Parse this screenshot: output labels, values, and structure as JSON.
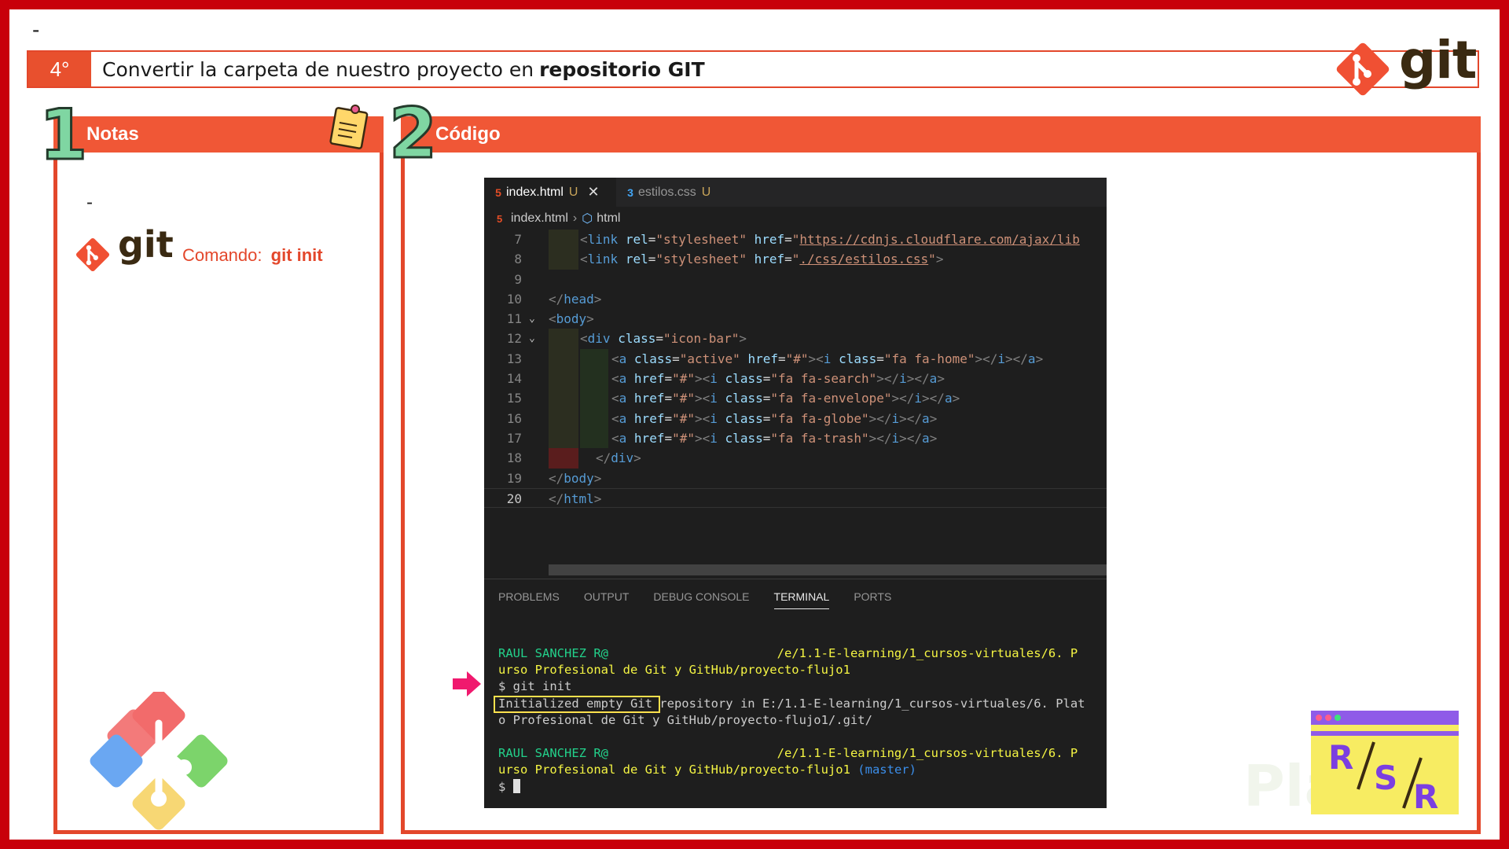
{
  "top_dash": "-",
  "header": {
    "step_number": "4°",
    "title_prefix": "Convertir la carpeta de nuestro proyecto en",
    "title_bold": "repositorio GIT",
    "logo_word": "git"
  },
  "panels": {
    "notas": {
      "number": "1",
      "title": "Notas"
    },
    "codigo": {
      "number": "2",
      "title": "Código"
    }
  },
  "notes": {
    "dash": "-",
    "logo_word": "git",
    "command_label": "Comando:",
    "command_value": "git init"
  },
  "editor": {
    "tabs": [
      {
        "label": "index.html",
        "status": "U",
        "active": true
      },
      {
        "label": "estilos.css",
        "status": "U",
        "active": false
      }
    ],
    "breadcrumb": [
      "index.html",
      "html"
    ],
    "line_numbers": [
      "7",
      "8",
      "9",
      "10",
      "11",
      "12",
      "13",
      "14",
      "15",
      "16",
      "17",
      "18",
      "19",
      "20"
    ],
    "current_line": "20",
    "code_lines": [
      "<link rel=\"stylesheet\" href=\"https://cdnjs.cloudflare.com/ajax/lib",
      "<link rel=\"stylesheet\" href=\"./css/estilos.css\">",
      "",
      "</head>",
      "<body>",
      "<div class=\"icon-bar\">",
      "<a class=\"active\" href=\"#\"><i class=\"fa fa-home\"></i></a>",
      "<a href=\"#\"><i class=\"fa fa-search\"></i></a>",
      "<a href=\"#\"><i class=\"fa fa-envelope\"></i></a>",
      "<a href=\"#\"><i class=\"fa fa-globe\"></i></a>",
      "<a href=\"#\"><i class=\"fa fa-trash\"></i></a>",
      "</div>",
      "</body>",
      "</html>"
    ]
  },
  "terminal": {
    "tabs": [
      "PROBLEMS",
      "OUTPUT",
      "DEBUG CONSOLE",
      "TERMINAL",
      "PORTS"
    ],
    "active_tab": "TERMINAL",
    "prompt_user": "RAUL SANCHEZ R@",
    "prompt_path_1": "/e/1.1-E-learning/1_cursos-virtuales/6. P",
    "prompt_path_2": "urso Profesional de Git y GitHub/proyecto-flujo1",
    "command": "$ git init",
    "output_1": "Initialized empty Git repository in E:/1.1-E-learning/1_cursos-virtuales/6. Plat",
    "output_2": "o Profesional de Git y GitHub/proyecto-flujo1/.git/",
    "branch": "(master)",
    "last_prompt": "$"
  },
  "colors": {
    "frame": "#c8000a",
    "accent": "#f05736",
    "git_orange": "#f05033",
    "text_brown": "#3a2a12"
  },
  "icons": [
    "git-logo-icon",
    "memo-note-icon",
    "html5-icon",
    "css3-icon",
    "close-icon",
    "cube-icon",
    "pointer-arrow-icon",
    "rsr-badge-icon"
  ]
}
